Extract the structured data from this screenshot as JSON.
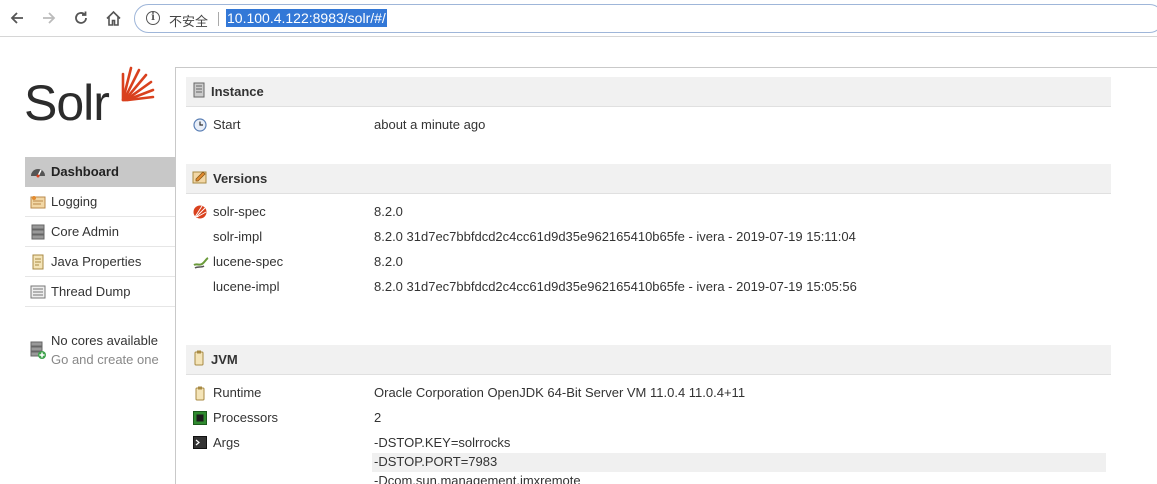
{
  "browser": {
    "insecure_label": "不安全",
    "url": "10.100.4.122:8983/solr/#/"
  },
  "logo": {
    "text": "Solr",
    "accent": "#d9411e"
  },
  "menu": [
    {
      "label": "Dashboard",
      "icon": "dashboard-icon",
      "active": true
    },
    {
      "label": "Logging",
      "icon": "logging-icon",
      "active": false
    },
    {
      "label": "Core Admin",
      "icon": "core-admin-icon",
      "active": false
    },
    {
      "label": "Java Properties",
      "icon": "java-properties-icon",
      "active": false
    },
    {
      "label": "Thread Dump",
      "icon": "thread-dump-icon",
      "active": false
    }
  ],
  "no_cores": {
    "title": "No cores available",
    "subtitle": "Go and create one"
  },
  "instance": {
    "title": "Instance",
    "rows": [
      {
        "label": "Start",
        "value": "about a minute ago"
      }
    ]
  },
  "versions": {
    "title": "Versions",
    "rows": [
      {
        "label": "solr-spec",
        "value": "8.2.0"
      },
      {
        "label": "solr-impl",
        "value": "8.2.0 31d7ec7bbfdcd2c4cc61d9d35e962165410b65fe - ivera - 2019-07-19 15:11:04"
      },
      {
        "label": "lucene-spec",
        "value": "8.2.0"
      },
      {
        "label": "lucene-impl",
        "value": "8.2.0 31d7ec7bbfdcd2c4cc61d9d35e962165410b65fe - ivera - 2019-07-19 15:05:56"
      }
    ]
  },
  "jvm": {
    "title": "JVM",
    "rows": [
      {
        "label": "Runtime",
        "value": "Oracle Corporation OpenJDK 64-Bit Server VM 11.0.4 11.0.4+11"
      },
      {
        "label": "Processors",
        "value": "2"
      },
      {
        "label": "Args",
        "value": ""
      }
    ],
    "args": [
      "-DSTOP.KEY=solrrocks",
      "-DSTOP.PORT=7983",
      "-Dcom.sun.management.jmxremote"
    ]
  }
}
